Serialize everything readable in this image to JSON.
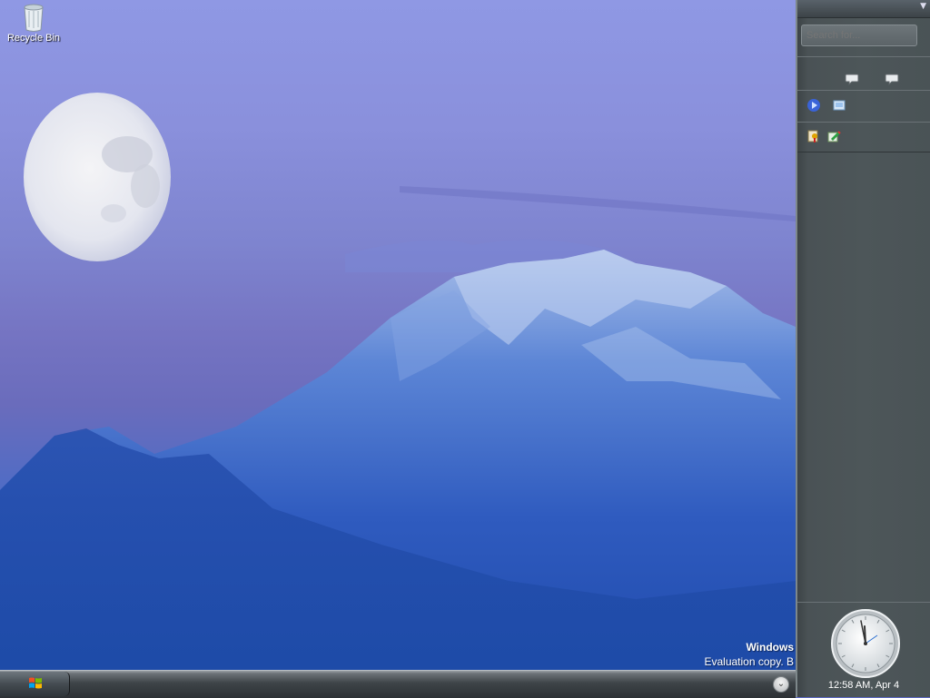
{
  "desktop": {
    "icons": [
      {
        "label": "Recycle Bin",
        "icon": "recycle-bin-icon"
      }
    ],
    "watermark": {
      "line1": "Windows",
      "line2": "Evaluation copy. B"
    }
  },
  "taskbar": {
    "start_icon": "windows-logo-icon",
    "tray_chevron_icon": "chevron-down-icon"
  },
  "sidebar": {
    "search": {
      "placeholder": "Search for..."
    },
    "menu_icon": "dropdown-arrow-icon",
    "gadget_row_icons": [
      "speech-bubble-icon",
      "speech-bubble-icon"
    ],
    "quick_launch_row1": [
      "media-player-icon",
      "show-desktop-icon"
    ],
    "quick_launch_row2": [
      "keys-icon",
      "pencil-document-icon"
    ],
    "clock": {
      "time": "12:58 AM, Apr 4"
    }
  },
  "colors": {
    "sidebar_bg": "#4d5659",
    "taskbar_bg": "#3e4448",
    "sky": "#8a90dc",
    "mountain": "#2f5bbf"
  }
}
